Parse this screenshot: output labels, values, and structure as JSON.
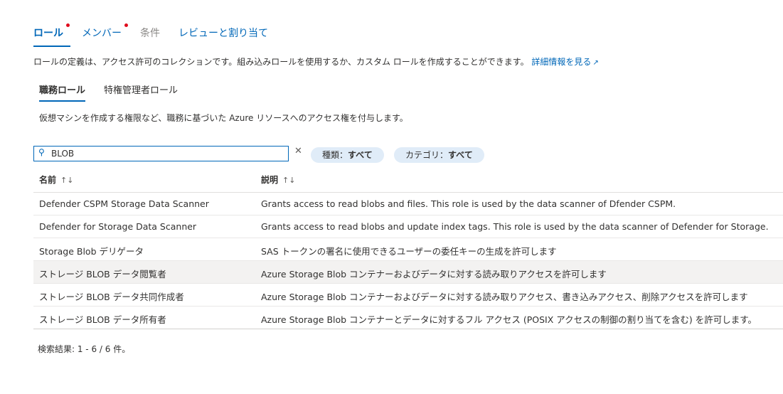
{
  "tabs": [
    {
      "label": "ロール",
      "required": true
    },
    {
      "label": "メンバー",
      "required": true
    },
    {
      "label": "条件",
      "required": false
    },
    {
      "label": "レビューと割り当て",
      "required": false
    }
  ],
  "description": "ロールの定義は、アクセス許可のコレクションです。組み込みロールを使用するか、カスタム ロールを作成することができます。",
  "learn_more": "詳細情報を見る",
  "subtabs": [
    "職務ロール",
    "特権管理者ロール"
  ],
  "subtab_description": "仮想マシンを作成する権限など、職務に基づいた Azure リソースへのアクセス権を付与します。",
  "search": {
    "value": "BLOB",
    "icon": "search-icon",
    "clear_icon": "close-icon"
  },
  "filters": [
    {
      "label": "種類：",
      "value": "すべて"
    },
    {
      "label": "カテゴリ：",
      "value": "すべて"
    }
  ],
  "table": {
    "columns": [
      "名前",
      "説明"
    ],
    "rows": [
      {
        "name": "Defender CSPM Storage Data Scanner",
        "description": "Grants access to read blobs and files. This role is used by the data scanner of Dfender CSPM."
      },
      {
        "name": "Defender for Storage Data Scanner",
        "description": "Grants access to read blobs and update index tags. This role is used by the data scanner of Defender for Storage."
      },
      {
        "name": "Storage Blob デリゲータ",
        "description": "SAS トークンの署名に使用できるユーザーの委任キーの生成を許可します"
      },
      {
        "name": "ストレージ BLOB データ閲覧者",
        "description": "Azure Storage Blob コンテナーおよびデータに対する読み取りアクセスを許可します"
      },
      {
        "name": "ストレージ BLOB データ共同作成者",
        "description": "Azure Storage Blob コンテナーおよびデータに対する読み取りアクセス、書き込みアクセス、削除アクセスを許可します"
      },
      {
        "name": "ストレージ BLOB データ所有者",
        "description": "Azure Storage Blob コンテナーとデータに対するフル アクセス (POSIX アクセスの制御の割り当てを含む) を許可します。"
      }
    ]
  },
  "result_text": "検索結果: 1 - 6 / 6 件。",
  "colors": {
    "accent": "#0067b8",
    "required_dot": "#e00b1c",
    "pill_bg": "#e0ecf8",
    "selected_row": "#f3f2f1"
  }
}
